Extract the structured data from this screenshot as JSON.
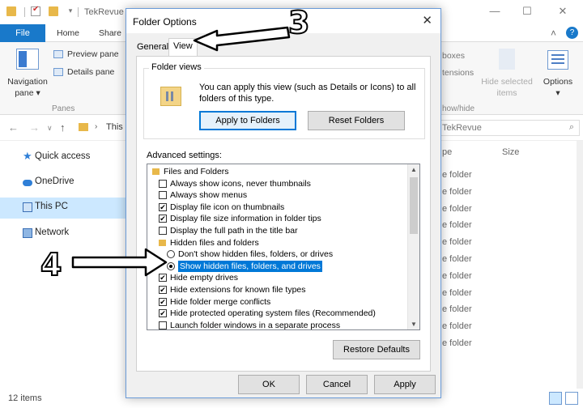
{
  "explorer": {
    "title": "TekRevue",
    "tabs": [
      "File",
      "Home",
      "Share"
    ],
    "ribbon": {
      "navigation_pane": "Navigation\npane ▾",
      "preview_pane": "Preview pane",
      "details_pane": "Details pane",
      "panes_group": "Panes",
      "boxes": "boxes",
      "extensions": "tensions",
      "hide_selected_items": "Hide selected\nitems",
      "show_hide_group": "how/hide",
      "options": "Options\n▾"
    },
    "address": {
      "path": "This",
      "search_placeholder": "h TekRevue"
    },
    "nav": {
      "items": [
        {
          "label": "Quick access",
          "icon": "star-icon"
        },
        {
          "label": "OneDrive",
          "icon": "cloud-icon"
        },
        {
          "label": "This PC",
          "icon": "computer-icon"
        },
        {
          "label": "Network",
          "icon": "network-icon"
        }
      ]
    },
    "columns": {
      "type": "pe",
      "size": "Size"
    },
    "file_rows": [
      "e folder",
      "e folder",
      "e folder",
      "e folder",
      "e folder",
      "e folder",
      "e folder",
      "e folder",
      "e folder",
      "e folder",
      "e folder"
    ],
    "status": "12 items"
  },
  "dialog": {
    "title": "Folder Options",
    "close_glyph": "✕",
    "tabs": [
      "General",
      "View"
    ],
    "folder_views": {
      "title": "Folder views",
      "text": "You can apply this view (such as Details or Icons) to all folders of this type.",
      "apply_button": "Apply to Folders",
      "reset_button": "Reset Folders"
    },
    "advanced_label": "Advanced settings:",
    "tree": [
      {
        "kind": "folder",
        "level": 0,
        "label": "Files and Folders"
      },
      {
        "kind": "checkbox",
        "level": 1,
        "checked": false,
        "label": "Always show icons, never thumbnails"
      },
      {
        "kind": "checkbox",
        "level": 1,
        "checked": false,
        "label": "Always show menus"
      },
      {
        "kind": "checkbox",
        "level": 1,
        "checked": true,
        "label": "Display file icon on thumbnails"
      },
      {
        "kind": "checkbox",
        "level": 1,
        "checked": true,
        "label": "Display file size information in folder tips"
      },
      {
        "kind": "checkbox",
        "level": 1,
        "checked": false,
        "label": "Display the full path in the title bar"
      },
      {
        "kind": "folder",
        "level": 1,
        "label": "Hidden files and folders"
      },
      {
        "kind": "radio",
        "level": 2,
        "checked": false,
        "label": "Don't show hidden files, folders, or drives"
      },
      {
        "kind": "radio",
        "level": 2,
        "checked": true,
        "selected": true,
        "label": "Show hidden files, folders, and drives"
      },
      {
        "kind": "checkbox",
        "level": 1,
        "checked": true,
        "label": "Hide empty drives"
      },
      {
        "kind": "checkbox",
        "level": 1,
        "checked": true,
        "label": "Hide extensions for known file types"
      },
      {
        "kind": "checkbox",
        "level": 1,
        "checked": true,
        "label": "Hide folder merge conflicts"
      },
      {
        "kind": "checkbox",
        "level": 1,
        "checked": true,
        "label": "Hide protected operating system files (Recommended)"
      },
      {
        "kind": "checkbox",
        "level": 1,
        "checked": false,
        "label": "Launch folder windows in a separate process"
      }
    ],
    "restore_button": "Restore Defaults",
    "footer": {
      "ok": "OK",
      "cancel": "Cancel",
      "apply": "Apply"
    }
  },
  "annotations": {
    "step_view_tab": "3",
    "step_show_hidden": "4"
  },
  "colors": {
    "accent": "#0078d7",
    "file_tab": "#1979ca",
    "folder": "#e8b84a",
    "selection": "#cce8ff"
  }
}
